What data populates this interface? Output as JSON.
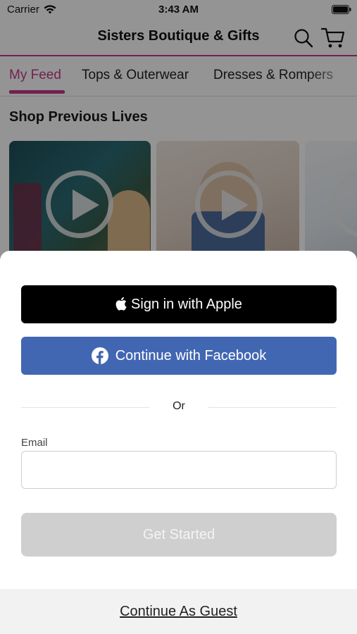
{
  "status_bar": {
    "carrier": "Carrier",
    "time": "3:43 AM",
    "icons": [
      "wifi-icon",
      "battery-icon"
    ]
  },
  "nav": {
    "title": "Sisters Boutique & Gifts",
    "icons": [
      "search-icon",
      "cart-icon"
    ]
  },
  "tabs": [
    {
      "label": "My Feed",
      "active": true
    },
    {
      "label": "Tops & Outerwear",
      "active": false
    },
    {
      "label": "Dresses & Rompers",
      "active": false
    }
  ],
  "section": {
    "title": "Shop Previous Lives"
  },
  "sheet": {
    "apple_button": "Sign in with Apple",
    "facebook_button": "Continue with Facebook",
    "divider_text": "Or",
    "email_label": "Email",
    "email_value": "",
    "email_placeholder": "",
    "get_started_button": "Get Started",
    "guest_link": "Continue As Guest"
  },
  "colors": {
    "accent": "#c43a8a",
    "apple_button": "#000000",
    "facebook_button": "#4267b2",
    "disabled_button": "#cfcfcf"
  }
}
